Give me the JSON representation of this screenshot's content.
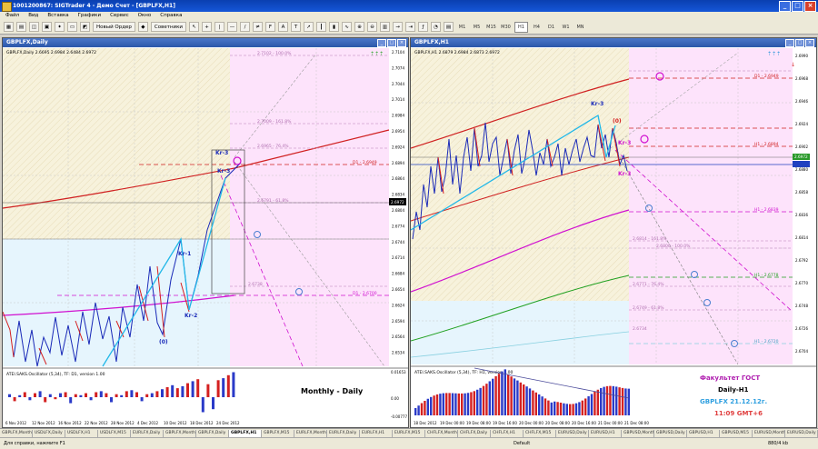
{
  "app": {
    "title": "1001200867: SIGTrader 4 - Демо Счет - [GBPLFX,H1]",
    "icon": "terminal-icon"
  },
  "menu": [
    "Файл",
    "Вид",
    "Вставка",
    "Графики",
    "Сервис",
    "Окно",
    "Справка"
  ],
  "toolbar": {
    "new_order": "Новый Ордер",
    "advisors": "Советники",
    "timeframes": [
      "M1",
      "M5",
      "M15",
      "M30",
      "H1",
      "H4",
      "D1",
      "W1",
      "MN"
    ]
  },
  "left_window": {
    "title": "GBPLFX,Daily",
    "info": "GBPLFX,Daily 2.6695 2.6984 2.6484 2.6972",
    "label": "Monthly - Daily",
    "osc_label": "ATEI.SAKS.Oscillator (5,34), TF: D1, version 1.00",
    "osc_scale": [
      "0.01653",
      "0.00",
      "-0.00777"
    ],
    "prices": [
      "2.7104",
      "2.7074",
      "2.7044",
      "2.7014",
      "2.6984",
      "2.6954",
      "2.6924",
      "2.6894",
      "2.6864",
      "2.6834",
      "2.6804",
      "2.6774",
      "2.6744",
      "2.6714",
      "2.6684",
      "2.6654",
      "2.6624",
      "2.6594",
      "2.6564",
      "2.6534"
    ],
    "current_price": "2.6972",
    "dates": [
      "6 Nov 2012",
      "12 Nov 2012",
      "16 Nov 2012",
      "22 Nov 2012",
      "28 Nov 2012",
      "4 Dec 2012",
      "10 Dec 2012",
      "18 Dec 2012",
      "24 Dec 2012"
    ],
    "wave_labels": [
      "Kr-3",
      "Kr-3",
      "Kr-1",
      "Kr-2",
      "(0)"
    ],
    "levels": [
      "2.7102 - 100.0%",
      "2.7009 - 161.8%",
      "2.6965 - 76.4%",
      "D1 - 2.6949",
      "2.6791 - 61.8%",
      "2.6738",
      "D1 - 2.6700"
    ]
  },
  "right_window": {
    "title": "GBPLFX,H1",
    "info": "GBPLFX,H1 2.6879 2.6984 2.6873 2.6972",
    "osc_label": "ATEI.SAKS.Oscillator (5,34), TF: H1, version 1.00",
    "prices": [
      "2.6990",
      "2.6968",
      "2.6946",
      "2.6924",
      "2.6902",
      "2.6880",
      "2.6858",
      "2.6836",
      "2.6814",
      "2.6792",
      "2.6770",
      "2.6748",
      "2.6726",
      "2.6704"
    ],
    "current_price": "2.6972",
    "dates": [
      "18 Dec 2012",
      "19 Dec 00:00",
      "19 Dec 08:00",
      "19 Dec 16:00",
      "20 Dec 00:00",
      "20 Dec 08:00",
      "20 Dec 16:00",
      "21 Dec 00:00",
      "21 Dec 08:00"
    ],
    "wave_labels": [
      "Kr-3",
      "(0)",
      "Kr-3",
      "Kr-3"
    ],
    "levels": [
      "D1 - 2.6949",
      "H1 - 2.6894",
      "H1 - 2.6839",
      "2.6814 - 161.8%",
      "2.6800 - 100.0%",
      "H1 - 2.6778",
      "2.6771 - 76.4%",
      "2.6749 - 61.8%",
      "2.6734",
      "H1 - 2.6720"
    ],
    "overlay": {
      "title": "Факультет ГОСТ",
      "tf": "Daily-H1",
      "pair_date": "GBPLFX 21.12.12г.",
      "time": "11:09 GMT+6"
    }
  },
  "tabs": [
    "GBPLFX,Monthly",
    "USDLFX,Daily",
    "USDLFX,H1",
    "USDLFX,M15",
    "EURLFX,Daily",
    "GBPLFX,Monthly",
    "GBPLFX,Daily",
    "GBPLFX,H1",
    "GBPLFX,M15",
    "EURLFX,Monthly",
    "EURLFX,Daily",
    "EURLFX,H1",
    "EURLFX,M15",
    "CHFLFX,Monthly",
    "CHFLFX,Daily",
    "CHFLFX,H1",
    "CHFLFX,M15",
    "EURUSD,Daily",
    "EURUSD,H1",
    "GBPUSD,Monthly",
    "GBPUSD,Daily",
    "GBPUSD,H1",
    "GBPUSD,M15",
    "EURUSD,Monthly",
    "EURUSD,Daily"
  ],
  "active_tab": "GBPLFX,H1",
  "status": {
    "help": "Для справки, нажмите F1",
    "profile": "Default",
    "traffic": "880/4 kb"
  },
  "colors": {
    "title_bar": "#1556d8",
    "zone_pink": "#fde3fb",
    "zone_blue": "#e6f5fd",
    "zone_tan": "#f7f2dc",
    "bull": "#1a2ab8",
    "bear": "#d42020",
    "wave": "#22b8e8",
    "ma_red": "#d02020",
    "ma_magenta": "#d010d0",
    "ma_green": "#20a020"
  }
}
